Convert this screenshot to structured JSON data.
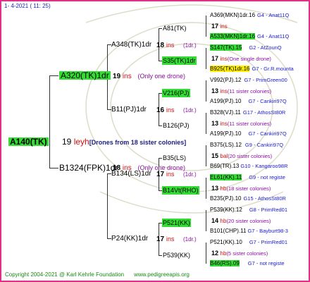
{
  "header": {
    "date": "1-   4-2021  ( 11:  25)"
  },
  "root": {
    "id": "A140(TK)",
    "gen": "19",
    "breeder": "leyh",
    "note": "[Drones from 18 sister colonies]"
  },
  "g1": {
    "upper": {
      "id": "A320(TK)1dr",
      "gen": "19",
      "breeder": "ins",
      "note": "(Only one drone)"
    },
    "lower": {
      "id": "B1324(FPK)1dr",
      "gen": "18",
      "breeder": "ins",
      "note": "(Only one drone)"
    }
  },
  "g2": [
    {
      "id": "A348(TK)1dr",
      "gen": "18",
      "breeder": "ins",
      "note": "(1dr.)"
    },
    {
      "id": "B11(PJ)1dr",
      "gen": "16",
      "breeder": "ins",
      "note": "(1dr.)"
    },
    {
      "id": "B134(LS)1dr",
      "gen": "17",
      "breeder": "ins",
      "note": "(1dr.)"
    },
    {
      "id": "P24(KK)1dr",
      "gen": "17",
      "breeder": "ins",
      "note": "(1dr.)"
    }
  ],
  "g3": [
    {
      "id": "A81(TK)"
    },
    {
      "id": "S35(TK)1dr"
    },
    {
      "id": "V216(PJ)"
    },
    {
      "id": "B126(PJ)"
    },
    {
      "id": "B35(LS)"
    },
    {
      "id": "B14Vt(RHO)"
    },
    {
      "id": "P521(KK)"
    },
    {
      "id": "P539(KK)"
    }
  ],
  "g4": [
    {
      "text": "A369(MKN)1dr.16",
      "ref": "G4 - Anat11Q"
    },
    {
      "gen": "17",
      "breeder": "ins",
      "note": ""
    },
    {
      "text": "A533(MKN)1dr.16",
      "ref": "G4 - Anat11Q"
    },
    {
      "text": "S147(TK).15",
      "ref": "G2 - AtZounQ"
    },
    {
      "gen": "17",
      "breeder": "ins",
      "note": "(One single drone)"
    },
    {
      "text": "B925(TK)1dr.16",
      "ref": "G7 - Gr.R.mounta"
    },
    {
      "text": "V992(PJ).12",
      "ref": "G7 - PrimGreen00"
    },
    {
      "gen": "13",
      "breeder": "ins",
      "note": "(11 sister colonies)"
    },
    {
      "text": "A199(PJ).10",
      "ref": "G7 - Cankiri97Q"
    },
    {
      "text": "B328(VJ).11",
      "ref": "G17 - AthosSt80R"
    },
    {
      "gen": "13",
      "breeder": "ins",
      "note": "(11 sister colonies)"
    },
    {
      "text": "A199(PJ).10",
      "ref": "G7 - Cankiri97Q"
    },
    {
      "text": "B375(LS).12",
      "ref": "G9 - Cankiri97Q"
    },
    {
      "gen": "15",
      "breeder": "bal",
      "note": "(20 sister colonies)"
    },
    {
      "text": "B69(TR).13",
      "ref": "G10 - Kangaroo98R"
    },
    {
      "text": "EL61(KK).11",
      "ref": "G9 - not registe"
    },
    {
      "gen": "13",
      "breeder": "hb",
      "note": "(18 sister colonies)"
    },
    {
      "text": "B235(PJ).10",
      "ref": "G15 - AthosSt80R"
    },
    {
      "text": "P539(KK).12",
      "ref": "G8 - PrimRed01"
    },
    {
      "gen": "14",
      "breeder": "hb",
      "note": "(20 sister colonies)"
    },
    {
      "text": "B101(CHP).11",
      "ref": "G7 - Bayburt98-3"
    },
    {
      "text": "P521(KK).10",
      "ref": "G7 - PrimRed01"
    },
    {
      "gen": "12",
      "breeder": "hb",
      "note": "(5 sister colonies)"
    },
    {
      "text": "B46(RS).09",
      "ref": "G7 - not registe"
    }
  ],
  "footer": {
    "copyright": "Copyright 2004-2021 @ Karl Kehrle Foundation",
    "site": "www.pedigreeapis.org"
  },
  "colors": {
    "frame": "#e0308a",
    "highlight": "#33dd33",
    "highlight_yellow": "#ffee00",
    "breeder": "#d01010",
    "note": "#8a10a0",
    "ref": "#1a1ad0",
    "footer": "#1b8a1b"
  }
}
